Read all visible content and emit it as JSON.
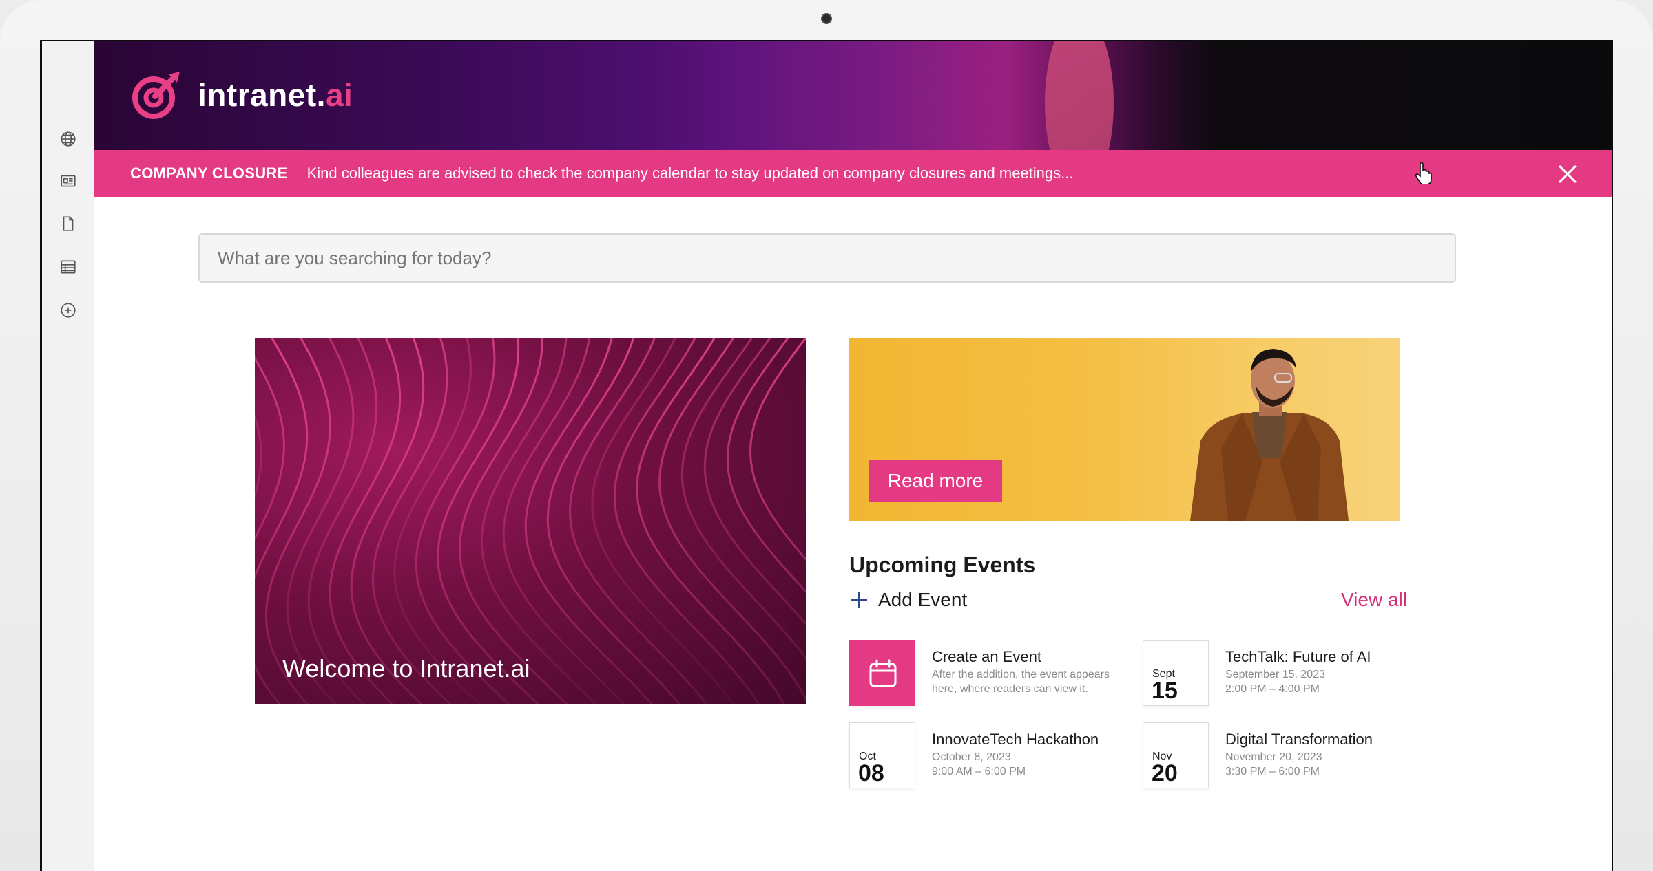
{
  "brand": {
    "name_main": "intranet.",
    "name_accent": "ai"
  },
  "closure": {
    "title": "COMPANY CLOSURE",
    "message": "Kind colleagues are advised to check the company calendar to stay updated on company closures and meetings..."
  },
  "search": {
    "placeholder": "What are you searching for today?"
  },
  "hero": {
    "title": "Welcome to Intranet.ai"
  },
  "promo": {
    "button_label": "Read more"
  },
  "events": {
    "heading": "Upcoming Events",
    "add_label": "Add Event",
    "view_all": "View all",
    "items": [
      {
        "month": "",
        "day": "",
        "title": "Create an Event",
        "line1": "After the addition, the event appears",
        "line2": "here, where readers can view it."
      },
      {
        "month": "Sept",
        "day": "15",
        "title": "TechTalk: Future of AI",
        "line1": "September 15, 2023",
        "line2": "2:00 PM – 4:00 PM"
      },
      {
        "month": "Oct",
        "day": "08",
        "title": "InnovateTech Hackathon",
        "line1": "October 8, 2023",
        "line2": "9:00 AM – 6:00 PM"
      },
      {
        "month": "Nov",
        "day": "20",
        "title": "Digital Transformation",
        "line1": "November 20, 2023",
        "line2": "3:30 PM – 6:00 PM"
      }
    ]
  },
  "sidebar": {
    "icons": [
      "globe-icon",
      "news-icon",
      "document-icon",
      "table-icon",
      "add-circle-icon"
    ]
  },
  "colors": {
    "accent": "#e33a83",
    "header_dark": "#2a0535",
    "promo_yellow": "#f4bf45"
  }
}
